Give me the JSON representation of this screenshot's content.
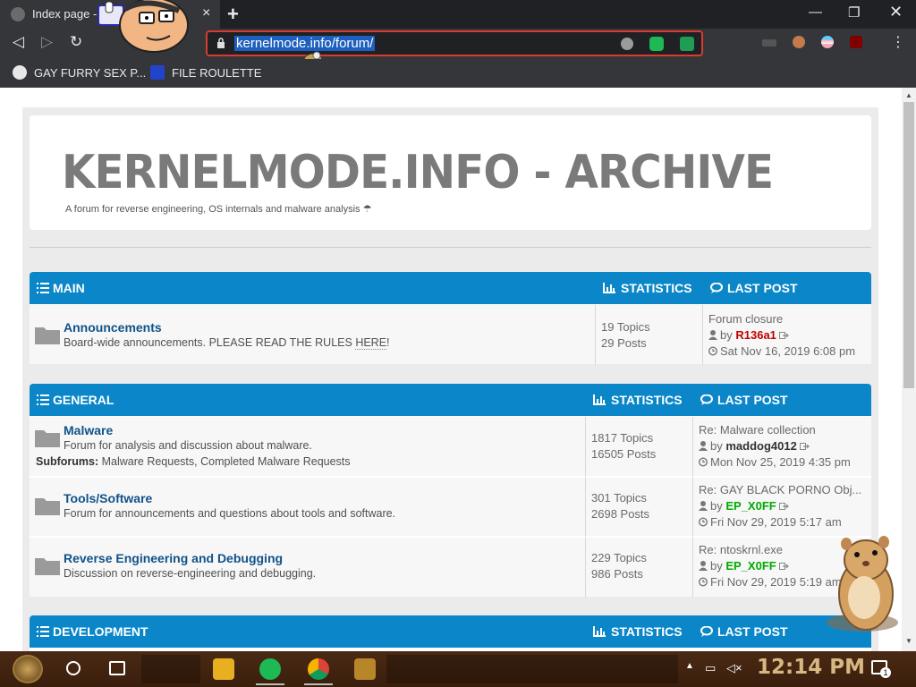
{
  "browser": {
    "tab_title": "Index page -",
    "tab_close": "×",
    "new_tab": "+",
    "window_controls": {
      "minimize": "—",
      "maximize": "❐",
      "close": "✕"
    },
    "url": "kernelmode.info/forum/",
    "nav": {
      "back": "◁",
      "forward": "▷",
      "reload": "↻"
    },
    "menu": "⋮",
    "extensions": [
      "shield-ext-icon",
      "spotify-ext-icon",
      "adguard-ext-icon",
      "avatar-ext-icon",
      "pride-ext-icon",
      "ublock-ext-icon"
    ],
    "bookmarks": [
      {
        "label": "GAY FURRY SEX P...",
        "icon": "globe-icon"
      },
      {
        "label": "FILE ROULETTE",
        "icon": "file-roulette-icon"
      }
    ]
  },
  "site": {
    "title": "KERNELMODE.INFO - ARCHIVE",
    "description": "A forum for reverse engineering, OS internals and malware analysis ☂"
  },
  "sections": [
    {
      "title": "MAIN",
      "stats_label": "STATISTICS",
      "last_post_label": "LAST POST",
      "forums": [
        {
          "name": "Announcements",
          "description": "Board-wide announcements. PLEASE READ THE RULES ",
          "description_link": "HERE",
          "description_tail": "!",
          "topics": "19 Topics",
          "posts": "29 Posts",
          "last_title": "Forum closure",
          "last_by": "by",
          "last_user": "R136a1",
          "last_time": "Sat Nov 16, 2019 6:08 pm"
        }
      ]
    },
    {
      "title": "GENERAL",
      "stats_label": "STATISTICS",
      "last_post_label": "LAST POST",
      "forums": [
        {
          "name": "Malware",
          "description": "Forum for analysis and discussion about malware.",
          "subforums_label": "Subforums:",
          "subforums": "Malware Requests, Completed Malware Requests",
          "topics": "1817 Topics",
          "posts": "16505 Posts",
          "last_title": "Re: Malware collection",
          "last_by": "by",
          "last_user": "maddog4012",
          "last_time": "Mon Nov 25, 2019 4:35 pm"
        },
        {
          "name": "Tools/Software",
          "description": "Forum for announcements and questions about tools and software.",
          "topics": "301 Topics",
          "posts": "2698 Posts",
          "last_title": "Re: GAY BLACK PORNO Obj...",
          "last_by": "by",
          "last_user": "EP_X0FF",
          "last_time": "Fri Nov 29, 2019 5:17 am"
        },
        {
          "name": "Reverse Engineering and Debugging",
          "description": "Discussion on reverse-engineering and debugging.",
          "topics": "229 Topics",
          "posts": "986 Posts",
          "last_title": "Re: ntoskrnl.exe",
          "last_by": "by",
          "last_user": "EP_X0FF",
          "last_time": "Fri Nov 29, 2019 5:19 am"
        }
      ]
    },
    {
      "title": "DEVELOPMENT",
      "stats_label": "STATISTICS",
      "last_post_label": "LAST POST",
      "forums": []
    }
  ],
  "taskbar": {
    "clock": "12:14 PM",
    "notification_count": "1",
    "apps": [
      "file-explorer-icon",
      "spotify-icon",
      "chrome-icon",
      "game-icon"
    ]
  },
  "colors": {
    "section_header": "#0b87c9",
    "forum_link": "#105289",
    "user_red": "#c00000",
    "user_green": "#00aa00",
    "omnibox_border": "#d93b2e",
    "taskbar": "#4a2a14"
  }
}
